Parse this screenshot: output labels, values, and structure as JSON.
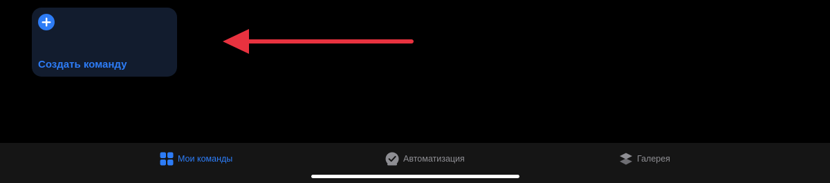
{
  "card": {
    "label": "Создать команду",
    "icon": "plus-circle-icon"
  },
  "annotation": {
    "icon": "red-arrow-left",
    "color": "#e8323f"
  },
  "tabbar": {
    "tabs": [
      {
        "label": "Мои команды",
        "icon": "grid-icon",
        "active": true
      },
      {
        "label": "Автоматизация",
        "icon": "automation-check-icon",
        "active": false
      },
      {
        "label": "Галерея",
        "icon": "layers-icon",
        "active": false
      }
    ]
  },
  "colors": {
    "accent": "#2d7cf6",
    "inactive": "#8e8e93",
    "card_bg": "#121c2e",
    "tabbar_bg": "#151515"
  }
}
